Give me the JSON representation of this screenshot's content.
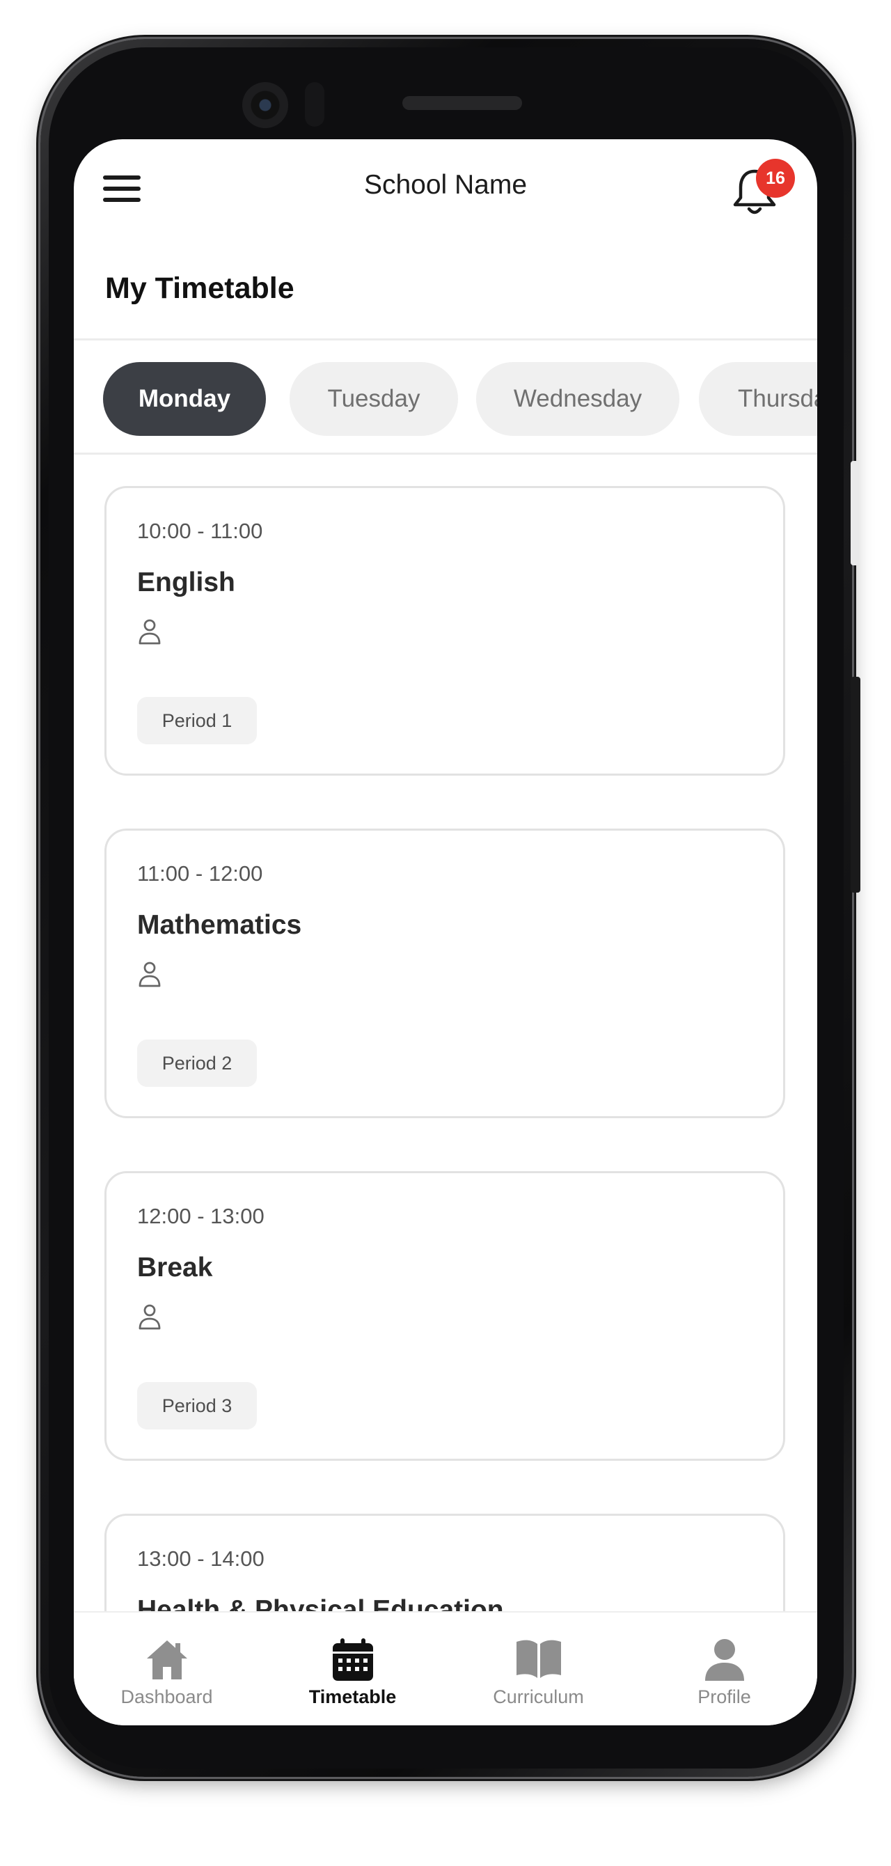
{
  "header": {
    "title": "School Name",
    "notification_count": "16"
  },
  "page": {
    "title": "My Timetable"
  },
  "days": [
    {
      "label": "Monday",
      "active": true
    },
    {
      "label": "Tuesday",
      "active": false
    },
    {
      "label": "Wednesday",
      "active": false
    },
    {
      "label": "Thursda",
      "active": false
    }
  ],
  "lessons": [
    {
      "time": "10:00 - 11:00",
      "subject": "English",
      "period": "Period 1"
    },
    {
      "time": "11:00 - 12:00",
      "subject": "Mathematics",
      "period": "Period 2"
    },
    {
      "time": "12:00 - 13:00",
      "subject": "Break",
      "period": "Period 3"
    },
    {
      "time": "13:00 - 14:00",
      "subject": "Health & Physical Education",
      "period": ""
    }
  ],
  "nav": [
    {
      "label": "Dashboard",
      "icon": "home-icon",
      "active": false
    },
    {
      "label": "Timetable",
      "icon": "calendar-icon",
      "active": true
    },
    {
      "label": "Curriculum",
      "icon": "book-icon",
      "active": false
    },
    {
      "label": "Profile",
      "icon": "user-icon",
      "active": false
    }
  ],
  "colors": {
    "active_tab": "#3c3f45",
    "badge": "#e7352c",
    "card_border": "#e2e2e2"
  }
}
